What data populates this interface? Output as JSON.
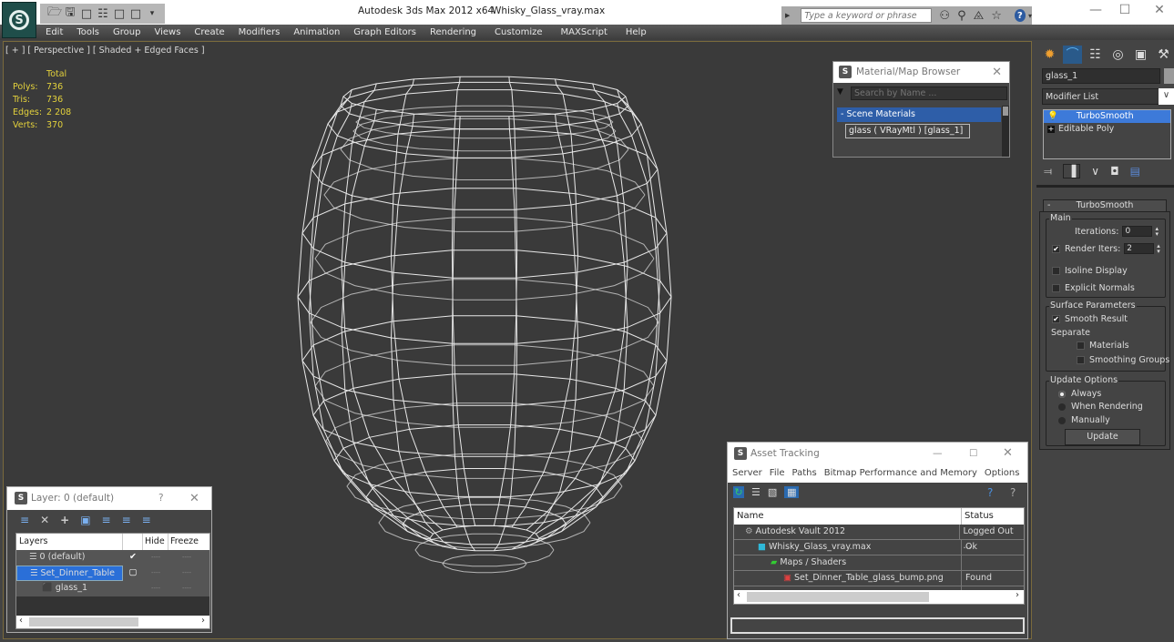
{
  "titlebar": {
    "app_title": "Autodesk 3ds Max  2012 x64",
    "file_title": "Whisky_Glass_vray.max",
    "search_placeholder": "Type a keyword or phrase",
    "quick_access_icons": [
      "new-icon",
      "open-icon",
      "save-icon",
      "undo-icon",
      "redo-icon",
      "project-icon",
      "dropdown-icon"
    ],
    "window_controls": {
      "minimize": "—",
      "maximize": "☐",
      "close": "✕"
    }
  },
  "menu": {
    "items": [
      "Edit",
      "Tools",
      "Group",
      "Views",
      "Create",
      "Modifiers",
      "Animation",
      "Graph Editors",
      "Rendering",
      "Customize",
      "MAXScript",
      "Help"
    ]
  },
  "viewport": {
    "label": "[ + ] [ Perspective ] [ Shaded + Edged Faces ]",
    "stats": {
      "header": "Total",
      "rows": [
        {
          "label": "Polys:",
          "value": "736"
        },
        {
          "label": "Tris:",
          "value": "736"
        },
        {
          "label": "Edges:",
          "value": "2 208"
        },
        {
          "label": "Verts:",
          "value": "370"
        }
      ]
    }
  },
  "material_browser": {
    "title": "Material/Map Browser",
    "search_placeholder": "Search by Name ...",
    "section": "- Scene Materials",
    "items": [
      "glass  ( VRayMtl ) [glass_1]"
    ]
  },
  "command_panel": {
    "object_name": "glass_1",
    "modifier_list": "Modifier List",
    "stack": [
      {
        "label": "TurboSmooth",
        "selected": true
      },
      {
        "label": "Editable Poly",
        "selected": false
      }
    ],
    "rollout_title": "TurboSmooth",
    "main_group": "Main",
    "iterations_label": "Iterations:",
    "iterations_value": "0",
    "render_iters_label": "Render Iters:",
    "render_iters_value": "2",
    "render_iters_checked": true,
    "isoline_label": "Isoline Display",
    "explicit_normals_label": "Explicit Normals",
    "surface_group": "Surface Parameters",
    "smooth_result_label": "Smooth Result",
    "separate_label": "Separate",
    "materials_label": "Materials",
    "smoothing_groups_label": "Smoothing Groups",
    "update_group": "Update Options",
    "update_options": [
      {
        "label": "Always",
        "selected": true
      },
      {
        "label": "When Rendering",
        "selected": false
      },
      {
        "label": "Manually",
        "selected": false
      }
    ],
    "update_button": "Update"
  },
  "asset_tracking": {
    "title": "Asset Tracking",
    "menu": [
      "Server",
      "File",
      "Paths",
      "Bitmap Performance and Memory",
      "Options"
    ],
    "columns": [
      "Name",
      "Status"
    ],
    "rows": [
      {
        "name": "Autodesk Vault 2012",
        "status": "Logged Out ...",
        "indent": 1
      },
      {
        "name": "Whisky_Glass_vray.max",
        "status": "Ok",
        "indent": 2
      },
      {
        "name": "Maps / Shaders",
        "status": "",
        "indent": 3
      },
      {
        "name": "Set_Dinner_Table_glass_bump.png",
        "status": "Found",
        "indent": 4
      }
    ]
  },
  "layer_manager": {
    "title": "Layer: 0 (default)",
    "help": "?",
    "columns": [
      "Layers",
      "",
      "Hide",
      "Freeze"
    ],
    "rows": [
      {
        "name": "0 (default)",
        "current": "✔",
        "hide": "----",
        "freeze": "----",
        "selected": false
      },
      {
        "name": "Set_Dinner_Table",
        "current": "▢",
        "hide": "----",
        "freeze": "----",
        "selected": true
      },
      {
        "name": "glass_1",
        "current": "",
        "hide": "----",
        "freeze": "----",
        "selected": false
      }
    ]
  }
}
